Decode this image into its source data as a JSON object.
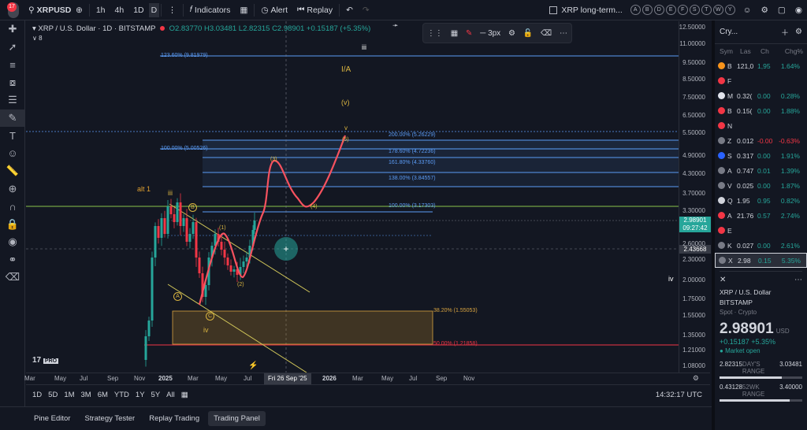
{
  "topbar": {
    "notifications": "17",
    "symbol": "XRPUSD",
    "intervals": [
      "1h",
      "4h",
      "1D"
    ],
    "indicators_label": "Indicators",
    "alert_label": "Alert",
    "replay_label": "Replay",
    "layout_name": "XRP long-term...",
    "letter_buttons": [
      "A",
      "B",
      "D",
      "E",
      "F",
      "S",
      "T",
      "W",
      "Y"
    ]
  },
  "legend": {
    "title": "XRP / U.S. Dollar · 1D · BITSTAMP",
    "open": "O2.83770",
    "high": "H3.03481",
    "low": "L2.82315",
    "close": "C2.98901",
    "change": "+0.15187 (+5.35%)",
    "collapsed_count": "8"
  },
  "drawing_toolbar": {
    "width_label": "3px"
  },
  "price_axis": {
    "labels": [
      "12.50000",
      "11.00000",
      "9.50000",
      "8.50000",
      "7.50000",
      "6.50000",
      "5.50000",
      "4.90000",
      "4.30000",
      "3.70000",
      "3.30000",
      "2.60000",
      "2.30000",
      "2.00000",
      "1.75000",
      "1.55000",
      "1.35000",
      "1.21000",
      "1.08000"
    ],
    "current_price": "2.98901",
    "countdown": "09:27:42",
    "crosshair_price": "2.43668"
  },
  "time_axis": {
    "labels": [
      "Mar",
      "May",
      "Jul",
      "Sep",
      "Nov",
      "2025",
      "Mar",
      "May",
      "Jul",
      "2026",
      "Mar",
      "May",
      "Jul",
      "Sep",
      "Nov"
    ],
    "crosshair_date": "Fri 26 Sep '25"
  },
  "fib_levels": [
    "123.60% (9.81979)",
    "200.00% (5.26229)",
    "178.60% (4.72236)",
    "161.80% (4.33760)",
    "138.00% (3.84557)",
    "100.00% (3.17303)",
    "100.00% (5.00526)",
    "38.20% (1.55053)",
    "50.00% (1.21858)"
  ],
  "wave_labels": {
    "iii_top": "iii",
    "IA": "I/A",
    "v_paren": "(v)",
    "v_small": "v",
    "five": "(5)",
    "three": "(3)",
    "four": "(4)",
    "one": "(1)",
    "two": "(2)",
    "alt1": "alt 1",
    "iii_left": "iii",
    "B": "B",
    "A": "A",
    "C": "C",
    "iv": "iv",
    "iv_right": "iv"
  },
  "range_bar": {
    "ranges": [
      "1D",
      "5D",
      "1M",
      "3M",
      "6M",
      "YTD",
      "1Y",
      "5Y",
      "All"
    ],
    "clock": "14:32:17 UTC"
  },
  "bottom_tabs": [
    "Pine Editor",
    "Strategy Tester",
    "Replay Trading",
    "Trading Panel"
  ],
  "watchlist": {
    "title": "Cry...",
    "columns": [
      "Sym",
      "Las",
      "Ch",
      "Chg%"
    ],
    "rows": [
      {
        "s": "B",
        "last": "121,0",
        "ch": "1,95",
        "pct": "1.64%",
        "color": "#f7931a",
        "dir": "pos"
      },
      {
        "s": "F",
        "last": "",
        "ch": "",
        "pct": "",
        "color": "#f23645",
        "dir": "neg"
      },
      {
        "s": "M",
        "last": "0.32(",
        "ch": "0.00",
        "pct": "0.28%",
        "color": "#e0e3eb",
        "dir": "pos"
      },
      {
        "s": "B",
        "last": "0.15(",
        "ch": "0.00",
        "pct": "1.88%",
        "color": "#f23645",
        "dir": "pos"
      },
      {
        "s": "N",
        "last": "",
        "ch": "",
        "pct": "",
        "color": "#f23645",
        "dir": "neg"
      },
      {
        "s": "Z",
        "last": "0.012",
        "ch": "-0.00",
        "pct": "-0.63%",
        "color": "#787b86",
        "dir": "neg"
      },
      {
        "s": "S",
        "last": "0.317",
        "ch": "0.00",
        "pct": "1.91%",
        "color": "#2962ff",
        "dir": "pos"
      },
      {
        "s": "A",
        "last": "0.747",
        "ch": "0.01",
        "pct": "1.39%",
        "color": "#787b86",
        "dir": "pos"
      },
      {
        "s": "V",
        "last": "0.025",
        "ch": "0.00",
        "pct": "1.87%",
        "color": "#787b86",
        "dir": "pos"
      },
      {
        "s": "Q",
        "last": "1.95",
        "ch": "0.95",
        "pct": "0.82%",
        "color": "#d1d4dc",
        "dir": "pos"
      },
      {
        "s": "A",
        "last": "21.76",
        "ch": "0.57",
        "pct": "2.74%",
        "color": "#f23645",
        "dir": "pos"
      },
      {
        "s": "E",
        "last": "",
        "ch": "",
        "pct": "",
        "color": "#f23645",
        "dir": "pos"
      },
      {
        "s": "K",
        "last": "0.027",
        "ch": "0.00",
        "pct": "2.61%",
        "color": "#787b86",
        "dir": "pos"
      },
      {
        "s": "X",
        "last": "2.98",
        "ch": "0.15",
        "pct": "5.35%",
        "color": "#787b86",
        "dir": "pos"
      }
    ]
  },
  "detail": {
    "name": "XRP / U.S. Dollar",
    "exchange": "BITSTAMP",
    "type": "Spot · Crypto",
    "price": "2.98901",
    "currency": "USD",
    "change": "+0.15187 +5.35%",
    "status": "Market open",
    "day_low": "2.82315",
    "day_high": "3.03481",
    "day_range_label": "DAY'S RANGE",
    "wk_low": "0.43128",
    "wk_high": "3.40000",
    "wk_range_label": "52WK RANGE"
  },
  "colors": {
    "up": "#26a69a",
    "down": "#f23645",
    "wave": "#f7525f",
    "accent": "#2962ff"
  }
}
